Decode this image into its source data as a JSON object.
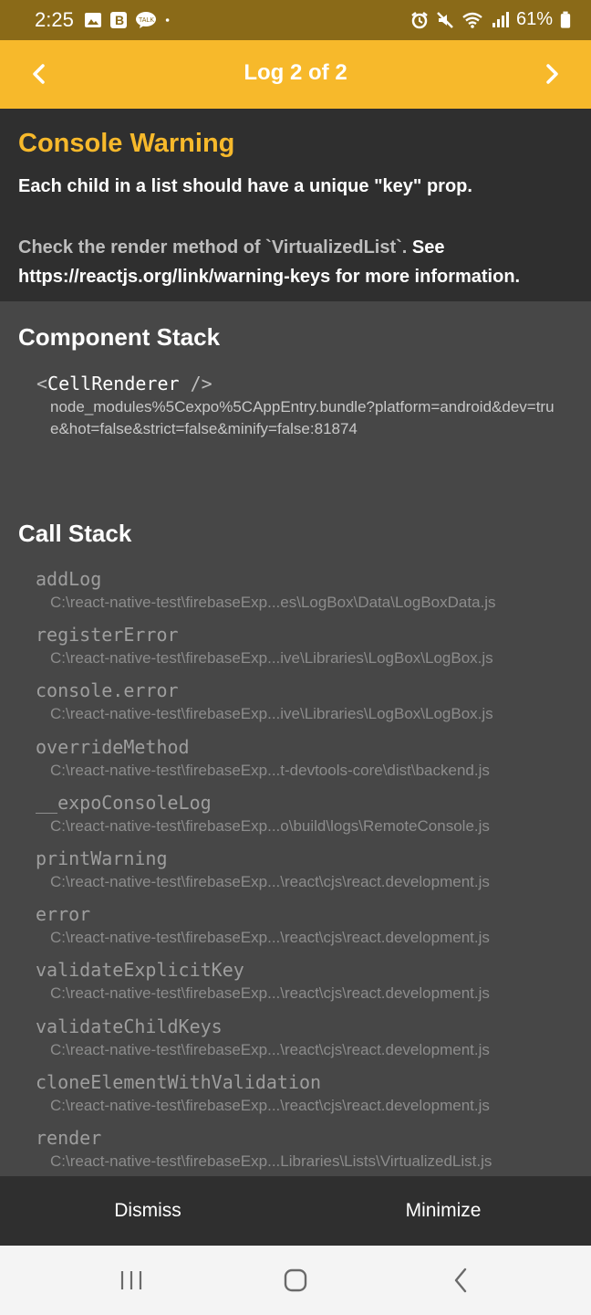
{
  "status_bar": {
    "time": "2:25",
    "battery": "61%",
    "left_icons": [
      "image-icon",
      "b-app-icon",
      "talk-icon",
      "dot-icon"
    ],
    "right_icons": [
      "alarm-icon",
      "mute-icon",
      "wifi-icon",
      "signal-icon",
      "battery-icon"
    ]
  },
  "header": {
    "title": "Log 2 of 2",
    "prev_icon": "chevron-left-icon",
    "next_icon": "chevron-right-icon",
    "color": "#f7b92b"
  },
  "warning": {
    "title": "Console Warning",
    "message": "Each child in a list should have a unique \"key\" prop.",
    "detail_grey": "Check the render method of `VirtualizedList`.",
    "detail_white_a": " See",
    "detail_white_b": "https://reactjs.org/link/warning-keys for more information."
  },
  "component_stack": {
    "title": "Component Stack",
    "open": "<",
    "component": "CellRenderer",
    "close": " />",
    "location": "node_modules%5Cexpo%5CAppEntry.bundle?platform=android&dev=true&hot=false&strict=false&minify=false:81874"
  },
  "call_stack": {
    "title": "Call Stack",
    "frames": [
      {
        "name": "addLog",
        "location": "C:\\react-native-test\\firebaseExp...es\\LogBox\\Data\\LogBoxData.js"
      },
      {
        "name": "registerError",
        "location": "C:\\react-native-test\\firebaseExp...ive\\Libraries\\LogBox\\LogBox.js"
      },
      {
        "name": "console.error",
        "location": "C:\\react-native-test\\firebaseExp...ive\\Libraries\\LogBox\\LogBox.js"
      },
      {
        "name": "overrideMethod",
        "location": "C:\\react-native-test\\firebaseExp...t-devtools-core\\dist\\backend.js"
      },
      {
        "name": "__expoConsoleLog",
        "location": "C:\\react-native-test\\firebaseExp...o\\build\\logs\\RemoteConsole.js"
      },
      {
        "name": "printWarning",
        "location": "C:\\react-native-test\\firebaseExp...\\react\\cjs\\react.development.js"
      },
      {
        "name": "error",
        "location": "C:\\react-native-test\\firebaseExp...\\react\\cjs\\react.development.js"
      },
      {
        "name": "validateExplicitKey",
        "location": "C:\\react-native-test\\firebaseExp...\\react\\cjs\\react.development.js"
      },
      {
        "name": "validateChildKeys",
        "location": "C:\\react-native-test\\firebaseExp...\\react\\cjs\\react.development.js"
      },
      {
        "name": "cloneElementWithValidation",
        "location": "C:\\react-native-test\\firebaseExp...\\react\\cjs\\react.development.js"
      },
      {
        "name": "render",
        "location": "C:\\react-native-test\\firebaseExp...Libraries\\Lists\\VirtualizedList.js"
      }
    ]
  },
  "actions": {
    "dismiss": "Dismiss",
    "minimize": "Minimize"
  },
  "system_nav": {
    "recent_icon": "recent-apps-icon",
    "home_icon": "home-icon",
    "back_icon": "back-icon"
  }
}
